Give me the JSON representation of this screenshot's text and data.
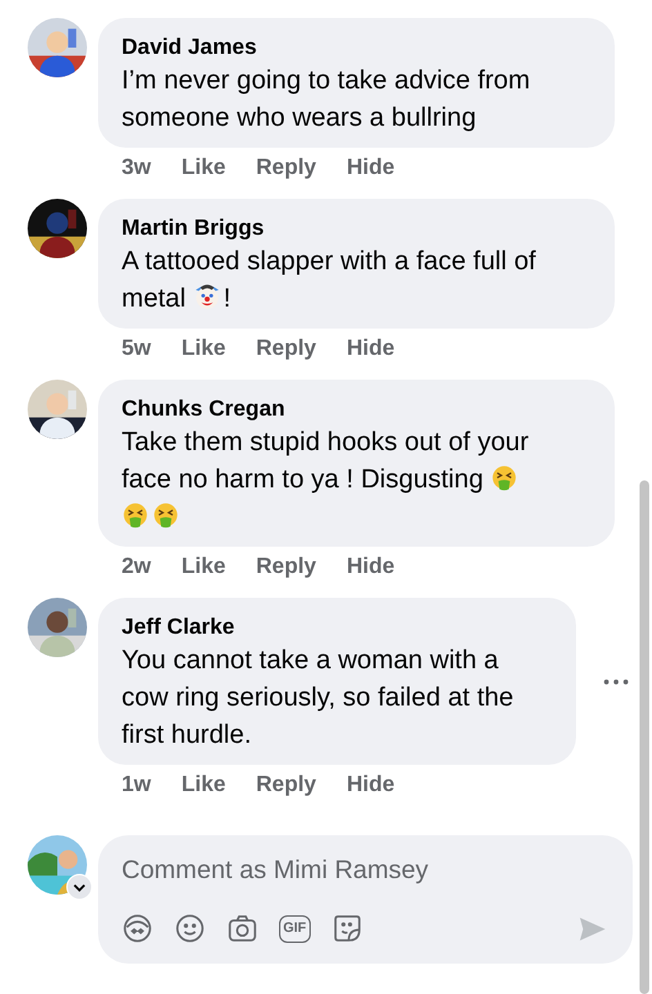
{
  "comments": [
    {
      "author": "David James",
      "avatar": {
        "kind": "picture"
      },
      "segments": [
        {
          "kind": "text",
          "text": "I’m never going to take advice from someone who wears a bullring"
        }
      ],
      "time": "3w",
      "actions": [
        "Like",
        "Reply",
        "Hide"
      ],
      "more": false
    },
    {
      "author": "Martin Briggs",
      "avatar": {
        "kind": "picture"
      },
      "segments": [
        {
          "kind": "text",
          "text": "A tattooed slapper with a face full of metal "
        },
        {
          "kind": "clown"
        },
        {
          "kind": "text",
          "text": "!"
        }
      ],
      "time": "5w",
      "actions": [
        "Like",
        "Reply",
        "Hide"
      ],
      "more": false
    },
    {
      "author": "Chunks Cregan",
      "avatar": {
        "kind": "picture"
      },
      "segments": [
        {
          "kind": "text",
          "text": "Take them stupid hooks out of your face no harm to ya ! Disgusting "
        },
        {
          "kind": "nauseated"
        },
        {
          "kind": "nauseated"
        },
        {
          "kind": "nauseated"
        }
      ],
      "time": "2w",
      "actions": [
        "Like",
        "Reply",
        "Hide"
      ],
      "more": false
    },
    {
      "author": "Jeff Clarke",
      "avatar": {
        "kind": "picture"
      },
      "segments": [
        {
          "kind": "text",
          "text": "You cannot take a woman with a cow ring seriously, so failed at the first hurdle."
        }
      ],
      "time": "1w",
      "actions": [
        "Like",
        "Reply",
        "Hide"
      ],
      "more": true
    }
  ],
  "composer": {
    "placeholder": "Comment as Mimi Ramsey",
    "tools": [
      {
        "kind": "avatar"
      },
      {
        "kind": "emoji"
      },
      {
        "kind": "camera"
      },
      {
        "kind": "gif",
        "label": "GIF"
      },
      {
        "kind": "sticker"
      }
    ]
  }
}
